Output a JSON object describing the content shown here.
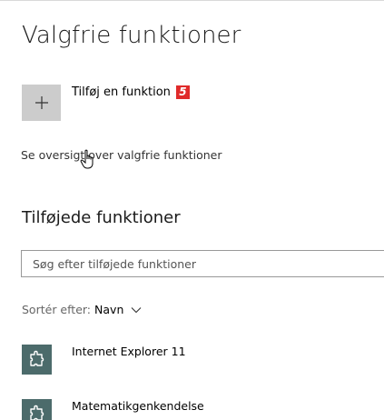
{
  "page": {
    "title": "Valgfrie funktioner"
  },
  "add": {
    "label": "Tilføj en funktion",
    "badge": "5"
  },
  "view_link": "Se oversigt over valgfrie funktioner",
  "installed": {
    "title": "Tilføjede funktioner",
    "search_placeholder": "Søg efter tilføjede funktioner",
    "sort_label": "Sortér efter:",
    "sort_value": "Navn",
    "items": [
      {
        "name": "Internet Explorer 11",
        "icon": "puzzle-icon"
      },
      {
        "name": "Matematikgenkendelse",
        "icon": "puzzle-icon"
      }
    ]
  },
  "colors": {
    "feature_icon_bg": "#4c6b6b",
    "add_button_bg": "#cccccc",
    "badge": "#e02b2b"
  }
}
